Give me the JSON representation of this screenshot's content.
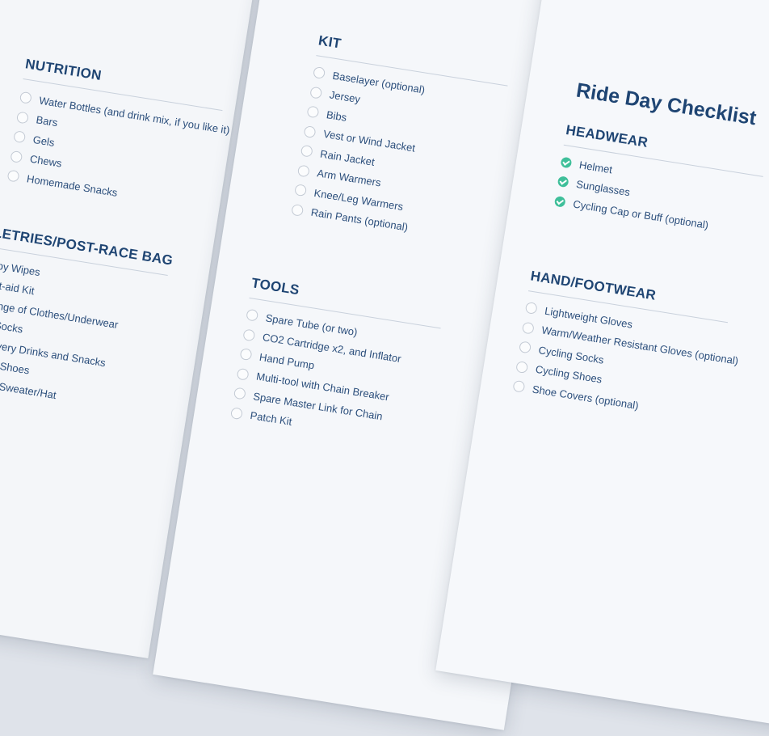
{
  "left_sheet": {
    "nutrition": {
      "title": "NUTRITION",
      "items": [
        "Water Bottles (and drink mix, if you like it)",
        "Bars",
        "Gels",
        "Chews",
        "Homemade Snacks"
      ]
    },
    "toiletries": {
      "title": "TOILETRIES/POST-RACE BAG",
      "items": [
        "Baby Wipes",
        "First-aid Kit",
        "Change of Clothes/Underwear",
        "Dry Socks",
        "Recovery Drinks and Snacks",
        "Street Shoes",
        "Jacket/Sweater/Hat"
      ]
    }
  },
  "middle_sheet": {
    "kit": {
      "title": "KIT",
      "items": [
        "Baselayer (optional)",
        "Jersey",
        "Bibs",
        "Vest or Wind Jacket",
        "Rain Jacket",
        "Arm Warmers",
        "Knee/Leg Warmers",
        "Rain Pants (optional)"
      ]
    },
    "tools": {
      "title": "TOOLS",
      "items": [
        "Spare Tube (or two)",
        "CO2 Cartridge x2, and Inflator",
        "Hand Pump",
        "Multi-tool with Chain Breaker",
        "Spare Master Link for Chain",
        "Patch Kit"
      ]
    }
  },
  "right_sheet": {
    "title": "Ride Day Checklist",
    "headwear": {
      "title": "HEADWEAR",
      "items": [
        "Helmet",
        "Sunglasses",
        "Cycling Cap or Buff (optional)"
      ]
    },
    "footwear": {
      "title": "HAND/FOOTWEAR",
      "items": [
        "Lightweight Gloves",
        "Warm/Weather Resistant Gloves (optional)",
        "Cycling Socks",
        "Cycling Shoes",
        "Shoe Covers (optional)"
      ]
    }
  },
  "colors": {
    "accent_check": "#3fbf9a",
    "heading": "#1f4573",
    "text": "#2c4f7c"
  }
}
